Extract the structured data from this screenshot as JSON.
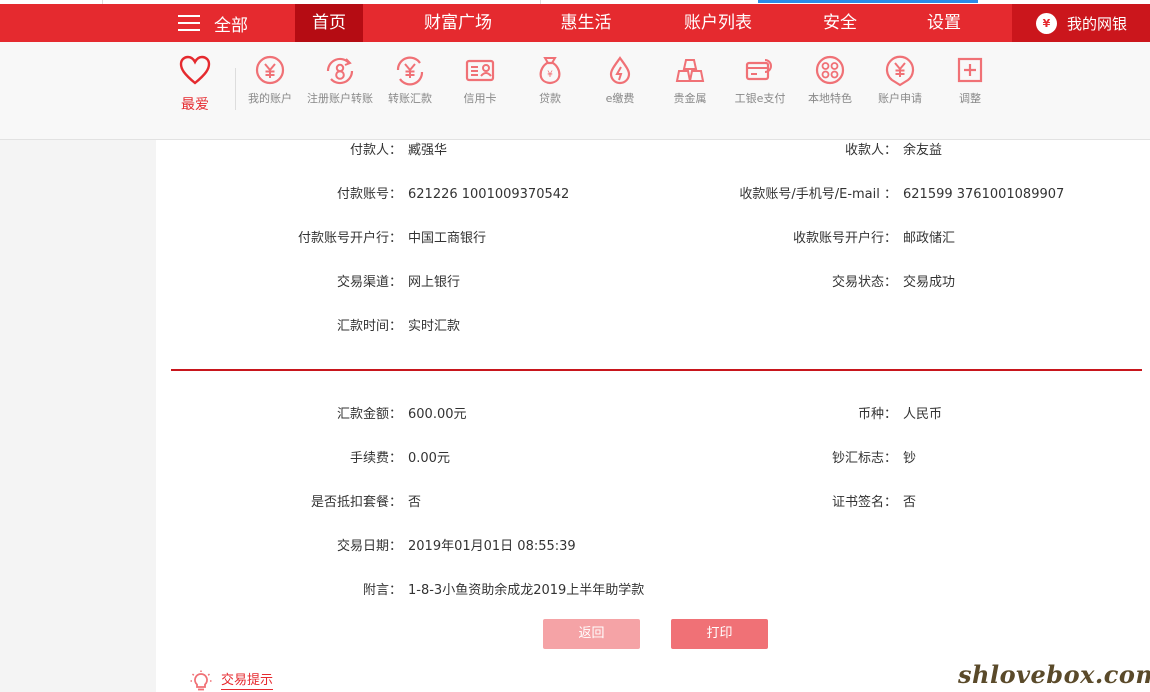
{
  "nav": {
    "all_label": "全部",
    "items": [
      "首页",
      "财富广场",
      "惠生活",
      "账户列表",
      "安全",
      "设置"
    ],
    "mine_label": "我的网银",
    "mine_coin": "¥"
  },
  "favorites": {
    "label": "最爱"
  },
  "quick_icons": [
    {
      "label": "我的账户",
      "icon": "yuan-circle-icon"
    },
    {
      "label": "注册账户转账",
      "icon": "register-transfer-icon"
    },
    {
      "label": "转账汇款",
      "icon": "transfer-yuan-icon"
    },
    {
      "label": "信用卡",
      "icon": "credit-card-icon"
    },
    {
      "label": "贷款",
      "icon": "money-bag-icon"
    },
    {
      "label": "e缴费",
      "icon": "drop-bolt-icon"
    },
    {
      "label": "贵金属",
      "icon": "gold-bars-icon"
    },
    {
      "label": "工银e支付",
      "icon": "card-pay-icon"
    },
    {
      "label": "本地特色",
      "icon": "circles-icon"
    },
    {
      "label": "账户申请",
      "icon": "yuan-pin-icon"
    },
    {
      "label": "调整",
      "icon": "plus-square-icon"
    }
  ],
  "details": {
    "payer_label": "付款人：",
    "payer": "臧强华",
    "payee_label": "收款人：",
    "payee": "余友益",
    "payer_acct_label": "付款账号：",
    "payer_acct": "621226 1001009370542",
    "payee_acct_label": "收款账号/手机号/E-mail ：",
    "payee_acct": "621599 3761001089907",
    "payer_bank_label": "付款账号开户行：",
    "payer_bank": "中国工商银行",
    "payee_bank_label": "收款账号开户行：",
    "payee_bank": "邮政储汇",
    "channel_label": "交易渠道：",
    "channel": "网上银行",
    "status_label": "交易状态：",
    "status": "交易成功",
    "time_label": "汇款时间：",
    "time": "实时汇款",
    "amount_label": "汇款金额：",
    "amount": "600.00元",
    "currency_label": "币种：",
    "currency": "人民币",
    "fee_label": "手续费：",
    "fee": "0.00元",
    "cash_label": "钞汇标志：",
    "cash": "钞",
    "package_label": "是否抵扣套餐：",
    "package": "否",
    "cert_label": "证书签名：",
    "cert": "否",
    "date_label": "交易日期：",
    "date": "2019年01月01日 08:55:39",
    "memo_label": "附言：",
    "memo": "1-8-3小鱼资助余成龙2019上半年助学款"
  },
  "buttons": {
    "back": "返回",
    "print": "打印"
  },
  "tip": {
    "label": "交易提示"
  },
  "watermark": "shlovebox.com",
  "colors": {
    "brand_red": "#e52a2f",
    "nav_active": "#b50c13",
    "divider": "#c8161d",
    "icon_red": "#f07176"
  }
}
